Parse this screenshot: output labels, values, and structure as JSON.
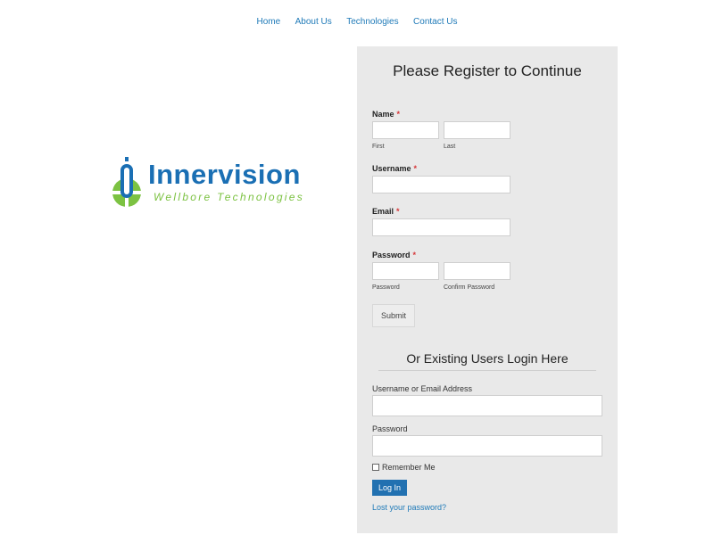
{
  "nav": {
    "items": [
      "Home",
      "About Us",
      "Technologies",
      "Contact Us"
    ]
  },
  "logo": {
    "word_part1": "Inner",
    "word_part2": "vision",
    "subtitle": "Wellbore Technologies",
    "colors": {
      "blue": "#1a6fb4",
      "green": "#7cc242"
    },
    "icon": "logo-mark-icon"
  },
  "register": {
    "title": "Please Register to Continue",
    "name_label": "Name",
    "required_marker": "*",
    "first_sublabel": "First",
    "last_sublabel": "Last",
    "username_label": "Username",
    "email_label": "Email",
    "password_label": "Password",
    "password_sublabel": "Password",
    "confirm_sublabel": "Confirm Password",
    "submit_label": "Submit"
  },
  "login": {
    "title": "Or Existing Users Login Here",
    "username_label": "Username or Email Address",
    "password_label": "Password",
    "remember_label": "Remember Me",
    "login_button": "Log In",
    "lost_password": "Lost your password?"
  },
  "colors": {
    "link": "#1f7ab8",
    "panel_bg": "#e9e9e9",
    "required": "#d63638",
    "button": "#2271b1"
  }
}
